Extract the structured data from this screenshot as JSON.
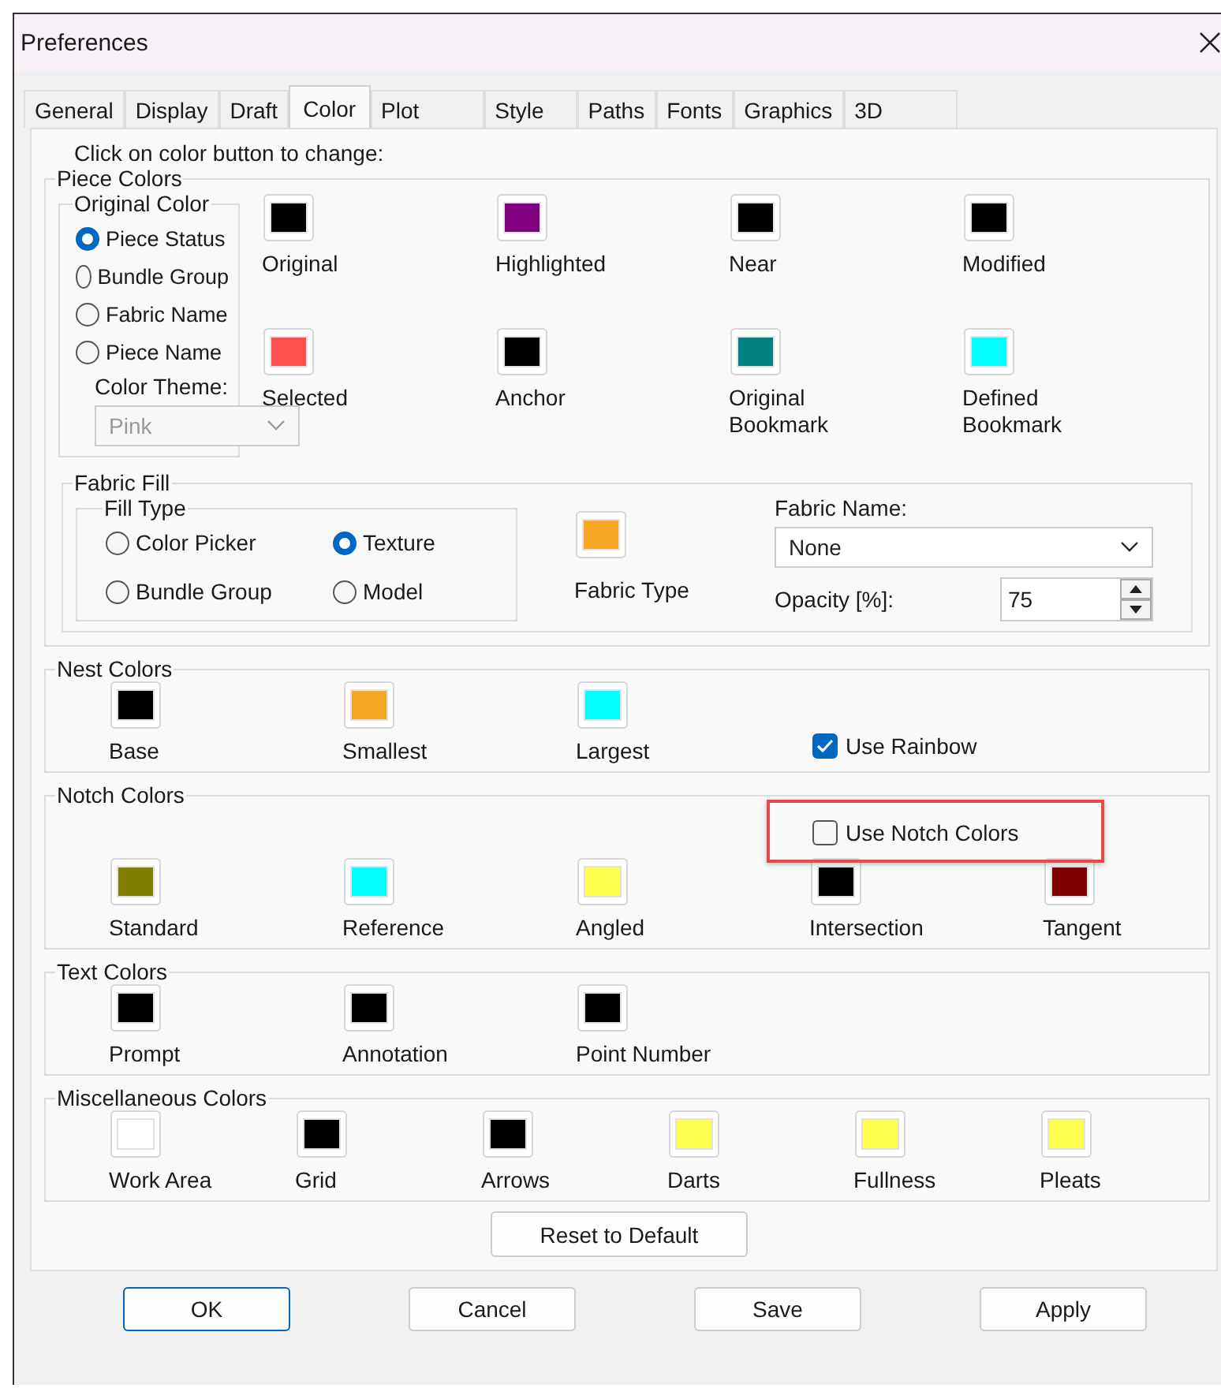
{
  "window": {
    "title": "Preferences"
  },
  "tabs": [
    {
      "label": "General",
      "selected": false
    },
    {
      "label": "Display",
      "selected": false
    },
    {
      "label": "Draft",
      "selected": false
    },
    {
      "label": "Color",
      "selected": true
    },
    {
      "label": "Plot",
      "selected": false
    },
    {
      "label": "Style",
      "selected": false
    },
    {
      "label": "Paths",
      "selected": false
    },
    {
      "label": "Fonts",
      "selected": false
    },
    {
      "label": "Graphics",
      "selected": false
    },
    {
      "label": "3D",
      "selected": false
    }
  ],
  "instruction": "Click on color button to change:",
  "piece_colors": {
    "title": "Piece Colors",
    "original_color": {
      "title": "Original Color",
      "options": [
        {
          "label": "Piece Status",
          "selected": true
        },
        {
          "label": "Bundle Group",
          "selected": false
        },
        {
          "label": "Fabric Name",
          "selected": false
        },
        {
          "label": "Piece Name",
          "selected": false
        }
      ],
      "theme_label": "Color Theme:",
      "theme": {
        "value": "Pink",
        "disabled": true
      }
    },
    "swatches": [
      {
        "label": "Original",
        "color": "#000000"
      },
      {
        "label": "Highlighted",
        "color": "#800080"
      },
      {
        "label": "Near",
        "color": "#000000"
      },
      {
        "label": "Modified",
        "color": "#000000"
      },
      {
        "label": "Selected",
        "color": "#ff5050"
      },
      {
        "label": "Anchor",
        "color": "#000000"
      },
      {
        "label": "Original Bookmark",
        "color": "#008080"
      },
      {
        "label": "Defined Bookmark",
        "color": "#00ffff"
      }
    ]
  },
  "fabric_fill": {
    "title": "Fabric Fill",
    "fill_type": {
      "title": "Fill Type",
      "options": [
        {
          "label": "Color Picker",
          "selected": false
        },
        {
          "label": "Texture",
          "selected": true
        },
        {
          "label": "Bundle Group",
          "selected": false
        },
        {
          "label": "Model",
          "selected": false
        }
      ]
    },
    "swatch": {
      "label": "Fabric Type",
      "color": "#f5a623"
    },
    "fabric_name": {
      "label": "Fabric Name:",
      "value": "None"
    },
    "opacity": {
      "label": "Opacity [%]:",
      "value": "75"
    }
  },
  "nest_colors": {
    "title": "Nest Colors",
    "swatches": [
      {
        "label": "Base",
        "color": "#000000"
      },
      {
        "label": "Smallest",
        "color": "#f5a623"
      },
      {
        "label": "Largest",
        "color": "#00ffff"
      }
    ],
    "use_rainbow": {
      "label": "Use Rainbow",
      "checked": true
    }
  },
  "notch_colors": {
    "title": "Notch Colors",
    "use_notch_colors": {
      "label": "Use Notch Colors",
      "checked": false,
      "highlighted": true
    },
    "swatches": [
      {
        "label": "Standard",
        "color": "#808000"
      },
      {
        "label": "Reference",
        "color": "#00ffff"
      },
      {
        "label": "Angled",
        "color": "#ffff50"
      },
      {
        "label": "Intersection",
        "color": "#000000"
      },
      {
        "label": "Tangent",
        "color": "#800000"
      }
    ]
  },
  "text_colors": {
    "title": "Text Colors",
    "swatches": [
      {
        "label": "Prompt",
        "color": "#000000"
      },
      {
        "label": "Annotation",
        "color": "#000000"
      },
      {
        "label": "Point Number",
        "color": "#000000"
      }
    ]
  },
  "misc_colors": {
    "title": "Miscellaneous Colors",
    "swatches": [
      {
        "label": "Work Area",
        "color": "#ffffff"
      },
      {
        "label": "Grid",
        "color": "#000000"
      },
      {
        "label": "Arrows",
        "color": "#000000"
      },
      {
        "label": "Darts",
        "color": "#ffff50"
      },
      {
        "label": "Fullness",
        "color": "#ffff50"
      },
      {
        "label": "Pleats",
        "color": "#ffff50"
      }
    ]
  },
  "reset_button": "Reset to Default",
  "buttons": [
    {
      "label": "OK",
      "default": true
    },
    {
      "label": "Cancel",
      "default": false
    },
    {
      "label": "Save",
      "default": false
    },
    {
      "label": "Apply",
      "default": false
    }
  ]
}
